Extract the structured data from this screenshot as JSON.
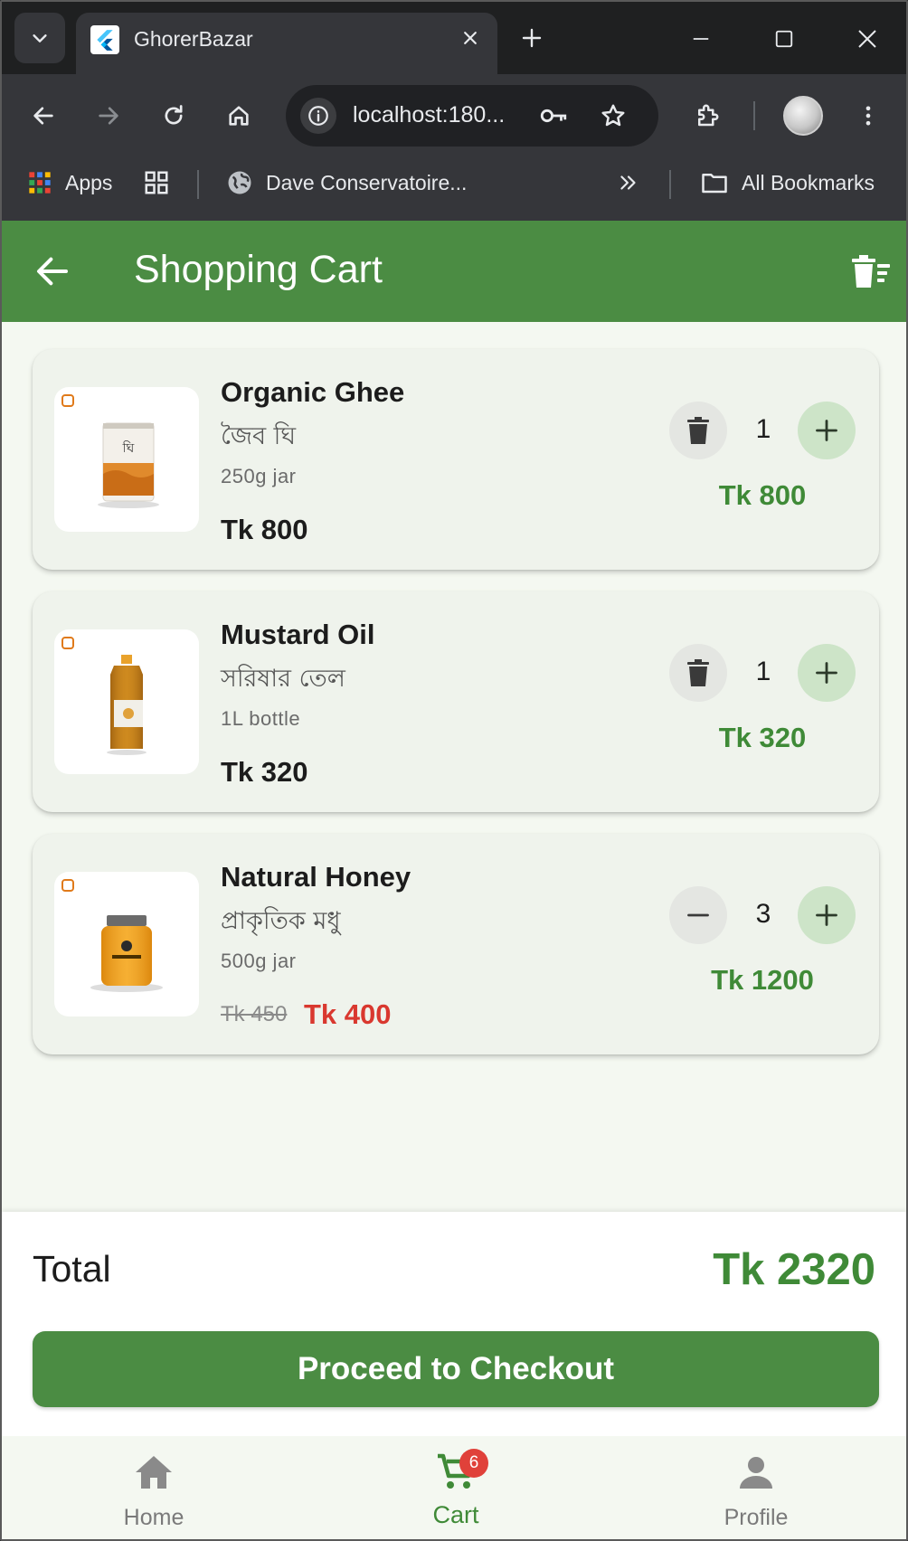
{
  "browser": {
    "tab_title": "GhorerBazar",
    "url": "localhost:180...",
    "bookmarks": {
      "apps_label": "Apps",
      "folder_label": "Dave Conservatoire...",
      "all_label": "All Bookmarks"
    }
  },
  "app": {
    "title": "Shopping Cart",
    "items": [
      {
        "name": "Organic Ghee",
        "name_bn": "জৈব ঘি",
        "unit": "250g jar",
        "price": "Tk 800",
        "quantity": "1",
        "line_total": "Tk 800",
        "decrement_icon": "trash-icon"
      },
      {
        "name": "Mustard Oil",
        "name_bn": "সরিষার তেল",
        "unit": "1L bottle",
        "price": "Tk 320",
        "quantity": "1",
        "line_total": "Tk 320",
        "decrement_icon": "trash-icon"
      },
      {
        "name": "Natural Honey",
        "name_bn": "প্রাকৃতিক মধু",
        "unit": "500g jar",
        "old_price": "Tk 450",
        "price": "Tk 400",
        "quantity": "3",
        "line_total": "Tk 1200",
        "decrement_icon": "minus-icon"
      }
    ],
    "summary": {
      "total_label": "Total",
      "total_value": "Tk 2320",
      "checkout_label": "Proceed to Checkout"
    },
    "nav": {
      "home": "Home",
      "cart": "Cart",
      "cart_badge": "6",
      "profile": "Profile"
    }
  },
  "colors": {
    "primary": "#4b8c43",
    "price_green": "#3f8a37",
    "sale_red": "#d9382f",
    "background": "#f4f8f1"
  }
}
